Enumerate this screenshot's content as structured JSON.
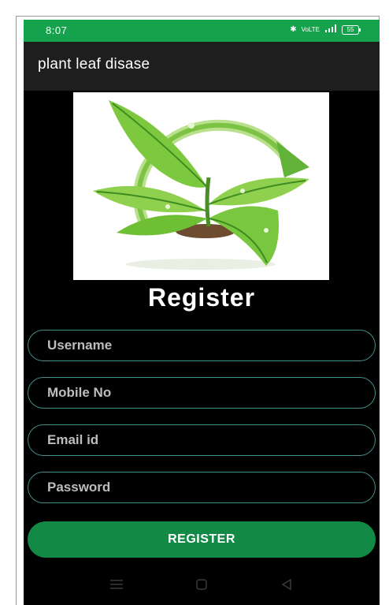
{
  "status_bar": {
    "time": "8:07",
    "icons_text": "✱ ᵛᵒˡᵗᵉ ⁴⁶ıl",
    "battery": "55"
  },
  "app_bar": {
    "title": "plant leaf disase"
  },
  "logo": {
    "icon": "plant-leaf-logo",
    "colors": [
      "#8fd14f",
      "#4caf2a",
      "#2e7d1f",
      "#6d4c2f"
    ]
  },
  "form": {
    "title": "Register",
    "fields": [
      {
        "name": "username",
        "placeholder": "Username",
        "value": ""
      },
      {
        "name": "mobile",
        "placeholder": "Mobile No",
        "value": ""
      },
      {
        "name": "email",
        "placeholder": "Email id",
        "value": ""
      },
      {
        "name": "password",
        "placeholder": "Password",
        "value": ""
      }
    ],
    "submit_label": "REGISTER"
  },
  "nav_bar": {
    "items": [
      "menu-icon",
      "home-icon",
      "back-icon"
    ]
  },
  "colors": {
    "status_bar": "#16a14c",
    "app_bar": "#1e1e1e",
    "background": "#000000",
    "field_border": "#3d8f86",
    "button": "#128a46"
  }
}
